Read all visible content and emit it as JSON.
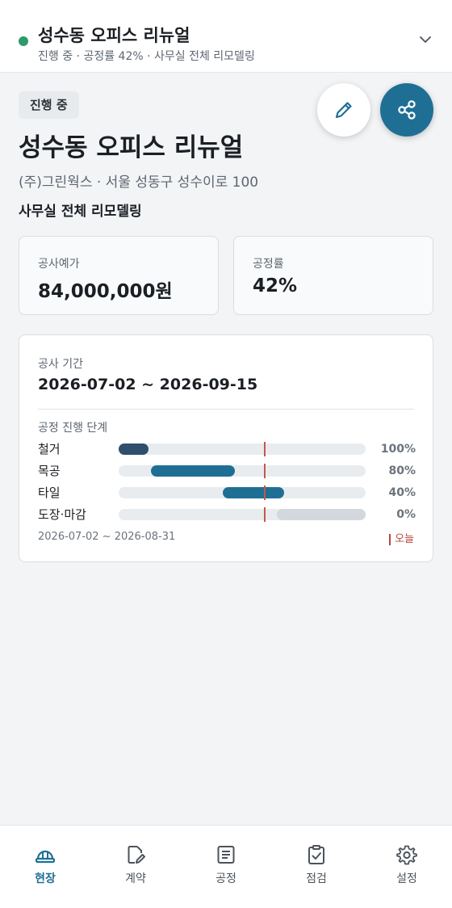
{
  "header": {
    "title": "성수동 오피스 리뉴얼",
    "subtitle": "진행 중 · 공정률 42% · 사무실 전체 리모델링",
    "status_color": "#2e9a6a"
  },
  "project": {
    "status_badge": "진행 중",
    "title": "성수동 오피스 리뉴얼",
    "client_line": "(주)그린웍스 · 서울 성동구 성수이로 100",
    "scope": "사무실 전체 리모델링"
  },
  "summary": {
    "budget_label": "공사예가",
    "budget_value": "84,000,000원",
    "progress_label": "공정률",
    "progress_value": "42%"
  },
  "schedule": {
    "period_label": "공사 기간",
    "period_range": "2026-07-02 ~ 2026-09-15",
    "stages_title": "공정 진행 단계",
    "axis_range": "2026-07-02 ~ 2026-08-31",
    "today_label": "오늘",
    "stages": [
      {
        "name": "철거",
        "percent": "100%",
        "start_frac": 0.0,
        "end_frac": 0.12,
        "color": "#2f4f6c"
      },
      {
        "name": "목공",
        "percent": "80%",
        "start_frac": 0.13,
        "end_frac": 0.47,
        "color": "#1f6f95"
      },
      {
        "name": "타일",
        "percent": "40%",
        "start_frac": 0.42,
        "end_frac": 0.67,
        "color": "#1f6f95"
      },
      {
        "name": "도장·마감",
        "percent": "0%",
        "start_frac": 0.64,
        "end_frac": 1.0,
        "color": "#d3d8de"
      }
    ],
    "today_frac": 0.59
  },
  "tabs": [
    {
      "label": "현장",
      "icon": "hardhat-icon",
      "active": true
    },
    {
      "label": "계약",
      "icon": "contract-edit-icon",
      "active": false
    },
    {
      "label": "공정",
      "icon": "list-doc-icon",
      "active": false
    },
    {
      "label": "점검",
      "icon": "clipboard-check-icon",
      "active": false
    },
    {
      "label": "설정",
      "icon": "gear-icon",
      "active": false
    }
  ],
  "colors": {
    "accent": "#1f6f95",
    "today_marker": "#b5483a"
  }
}
